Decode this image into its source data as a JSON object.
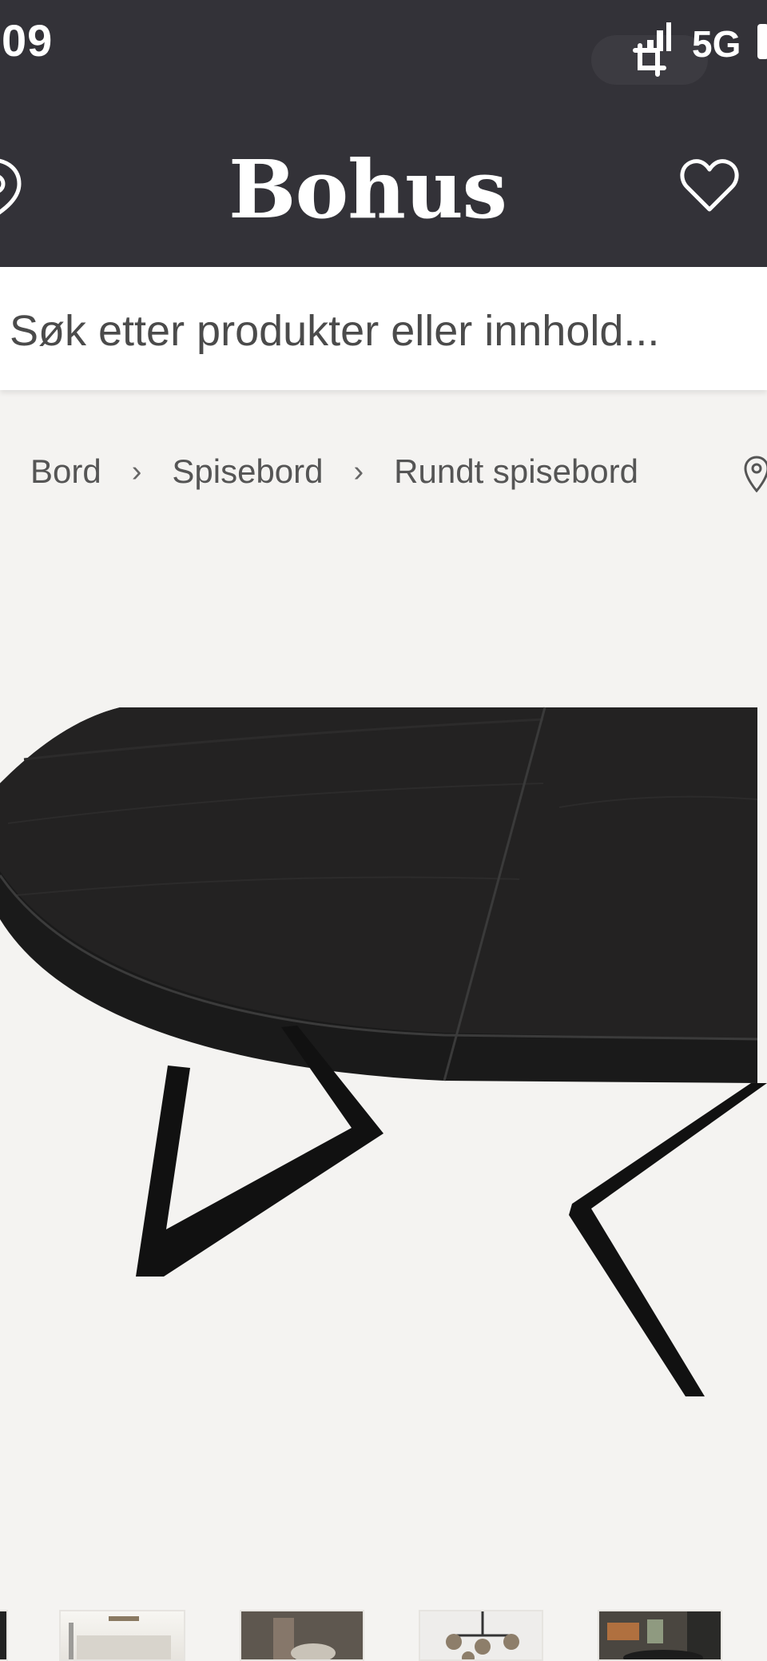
{
  "status_bar": {
    "time": "09",
    "network": "5G"
  },
  "header": {
    "brand": "Bohus",
    "location_icon": "location-pin-icon",
    "wishlist_icon": "heart-icon",
    "background": "#333238"
  },
  "search": {
    "placeholder": "Søk etter produkter eller innhold..."
  },
  "breadcrumb": {
    "items": [
      {
        "label": "Bord"
      },
      {
        "label": "Spisebord"
      },
      {
        "label": "Rundt spisebord"
      }
    ],
    "separator": "›"
  },
  "product": {
    "image_icon": "round-dining-table-image"
  },
  "gallery": {
    "thumbnails": [
      "thumb-1",
      "thumb-2",
      "thumb-3",
      "thumb-4",
      "thumb-5"
    ]
  }
}
